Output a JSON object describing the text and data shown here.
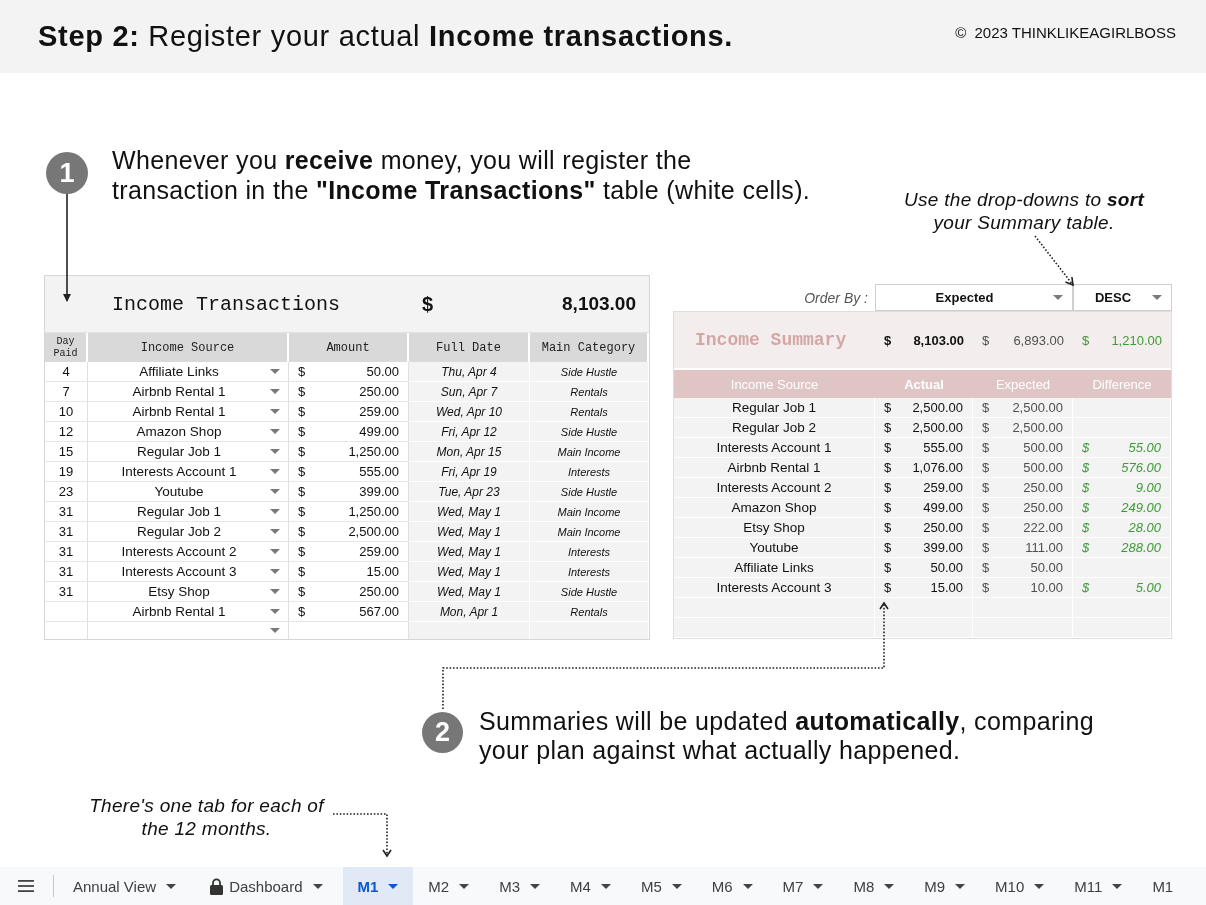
{
  "header": {
    "title": "**Step 2:** Register your actual **Income transactions.**",
    "copyright": "©  2023 THINKLIKEAGIRLBOSS"
  },
  "step_1": {
    "number": "1",
    "lines": [
      "Whenever you **receive** money, you will register the",
      "transaction in the **\"Income Transactions\"** table (white cells)."
    ]
  },
  "sort_note": {
    "lines": [
      "Use the drop-downs to **sort**",
      "your Summary table."
    ]
  },
  "transactions": {
    "title": "Income Transactions",
    "total": {
      "currency": "$",
      "value": "8,103.00"
    },
    "columns": [
      "Day Paid",
      "Income Source",
      "Amount",
      "Full Date",
      "Main Category"
    ],
    "rows": [
      {
        "day": "4",
        "source": "Affiliate Links",
        "amount": {
          "currency": "$",
          "value": "50.00"
        },
        "date": "Thu, Apr 4",
        "category": "Side Hustle"
      },
      {
        "day": "7",
        "source": "Airbnb Rental 1",
        "amount": {
          "currency": "$",
          "value": "250.00"
        },
        "date": "Sun, Apr 7",
        "category": "Rentals"
      },
      {
        "day": "10",
        "source": "Airbnb Rental 1",
        "amount": {
          "currency": "$",
          "value": "259.00"
        },
        "date": "Wed, Apr 10",
        "category": "Rentals"
      },
      {
        "day": "12",
        "source": "Amazon Shop",
        "amount": {
          "currency": "$",
          "value": "499.00"
        },
        "date": "Fri, Apr 12",
        "category": "Side Hustle"
      },
      {
        "day": "15",
        "source": "Regular Job 1",
        "amount": {
          "currency": "$",
          "value": "1,250.00"
        },
        "date": "Mon, Apr 15",
        "category": "Main Income"
      },
      {
        "day": "19",
        "source": "Interests Account 1",
        "amount": {
          "currency": "$",
          "value": "555.00"
        },
        "date": "Fri, Apr 19",
        "category": "Interests"
      },
      {
        "day": "23",
        "source": "Youtube",
        "amount": {
          "currency": "$",
          "value": "399.00"
        },
        "date": "Tue, Apr 23",
        "category": "Side Hustle"
      },
      {
        "day": "31",
        "source": "Regular Job 1",
        "amount": {
          "currency": "$",
          "value": "1,250.00"
        },
        "date": "Wed, May 1",
        "category": "Main Income"
      },
      {
        "day": "31",
        "source": "Regular Job 2",
        "amount": {
          "currency": "$",
          "value": "2,500.00"
        },
        "date": "Wed, May 1",
        "category": "Main Income"
      },
      {
        "day": "31",
        "source": "Interests Account 2",
        "amount": {
          "currency": "$",
          "value": "259.00"
        },
        "date": "Wed, May 1",
        "category": "Interests"
      },
      {
        "day": "31",
        "source": "Interests Account 3",
        "amount": {
          "currency": "$",
          "value": "15.00"
        },
        "date": "Wed, May 1",
        "category": "Interests"
      },
      {
        "day": "31",
        "source": "Etsy Shop",
        "amount": {
          "currency": "$",
          "value": "250.00"
        },
        "date": "Wed, May 1",
        "category": "Side Hustle"
      },
      {
        "source": "Airbnb Rental 1",
        "amount": {
          "currency": "$",
          "value": "567.00"
        },
        "date": "Mon, Apr 1",
        "category": "Rentals"
      }
    ]
  },
  "summary": {
    "order_by": {
      "label": "Order By :",
      "field": "Expected",
      "direction": "DESC"
    },
    "title": "Income Summary",
    "totals": {
      "actual": {
        "currency": "$",
        "value": "8,103.00"
      },
      "expected": {
        "currency": "$",
        "value": "6,893.00"
      },
      "difference": {
        "currency": "$",
        "value": "1,210.00"
      }
    },
    "columns": [
      "Income Source",
      "Actual",
      "Expected",
      "Difference"
    ],
    "rows": [
      {
        "source": "Regular Job 1",
        "actual": {
          "currency": "$",
          "value": "2,500.00"
        },
        "expected": {
          "currency": "$",
          "value": "2,500.00"
        }
      },
      {
        "source": "Regular Job 2",
        "actual": {
          "currency": "$",
          "value": "2,500.00"
        },
        "expected": {
          "currency": "$",
          "value": "2,500.00"
        }
      },
      {
        "source": "Interests Account 1",
        "actual": {
          "currency": "$",
          "value": "555.00"
        },
        "expected": {
          "currency": "$",
          "value": "500.00"
        },
        "difference": {
          "currency": "$",
          "value": "55.00"
        }
      },
      {
        "source": "Airbnb Rental 1",
        "actual": {
          "currency": "$",
          "value": "1,076.00"
        },
        "expected": {
          "currency": "$",
          "value": "500.00"
        },
        "difference": {
          "currency": "$",
          "value": "576.00"
        }
      },
      {
        "source": "Interests Account 2",
        "actual": {
          "currency": "$",
          "value": "259.00"
        },
        "expected": {
          "currency": "$",
          "value": "250.00"
        },
        "difference": {
          "currency": "$",
          "value": "9.00"
        }
      },
      {
        "source": "Amazon Shop",
        "actual": {
          "currency": "$",
          "value": "499.00"
        },
        "expected": {
          "currency": "$",
          "value": "250.00"
        },
        "difference": {
          "currency": "$",
          "value": "249.00"
        }
      },
      {
        "source": "Etsy Shop",
        "actual": {
          "currency": "$",
          "value": "250.00"
        },
        "expected": {
          "currency": "$",
          "value": "222.00"
        },
        "difference": {
          "currency": "$",
          "value": "28.00"
        }
      },
      {
        "source": "Youtube",
        "actual": {
          "currency": "$",
          "value": "399.00"
        },
        "expected": {
          "currency": "$",
          "value": "111.00"
        },
        "difference": {
          "currency": "$",
          "value": "288.00"
        }
      },
      {
        "source": "Affiliate Links",
        "actual": {
          "currency": "$",
          "value": "50.00"
        },
        "expected": {
          "currency": "$",
          "value": "50.00"
        }
      },
      {
        "source": "Interests Account 3",
        "actual": {
          "currency": "$",
          "value": "15.00"
        },
        "expected": {
          "currency": "$",
          "value": "10.00"
        },
        "difference": {
          "currency": "$",
          "value": "5.00"
        }
      }
    ]
  },
  "step_2": {
    "number": "2",
    "lines": [
      "Summaries will be updated **automatically**, comparing",
      "your plan against what actually happened."
    ]
  },
  "tabs_note": {
    "lines": [
      "There's one tab for each of",
      "the 12 months."
    ]
  },
  "tabs": [
    {
      "label": "Annual View",
      "selected": false,
      "locked": false,
      "caret": true
    },
    {
      "label": "Dashboard",
      "selected": false,
      "locked": true,
      "caret": true
    },
    {
      "label": "M1",
      "selected": true,
      "locked": false,
      "caret": true
    },
    {
      "label": "M2",
      "selected": false,
      "locked": false,
      "caret": true
    },
    {
      "label": "M3",
      "selected": false,
      "locked": false,
      "caret": true
    },
    {
      "label": "M4",
      "selected": false,
      "locked": false,
      "caret": true
    },
    {
      "label": "M5",
      "selected": false,
      "locked": false,
      "caret": true
    },
    {
      "label": "M6",
      "selected": false,
      "locked": false,
      "caret": true
    },
    {
      "label": "M7",
      "selected": false,
      "locked": false,
      "caret": true
    },
    {
      "label": "M8",
      "selected": false,
      "locked": false,
      "caret": true
    },
    {
      "label": "M9",
      "selected": false,
      "locked": false,
      "caret": true
    },
    {
      "label": "M10",
      "selected": false,
      "locked": false,
      "caret": true
    },
    {
      "label": "M11",
      "selected": false,
      "locked": false,
      "caret": true
    },
    {
      "label": "M1",
      "selected": false,
      "locked": false,
      "caret": false
    }
  ]
}
